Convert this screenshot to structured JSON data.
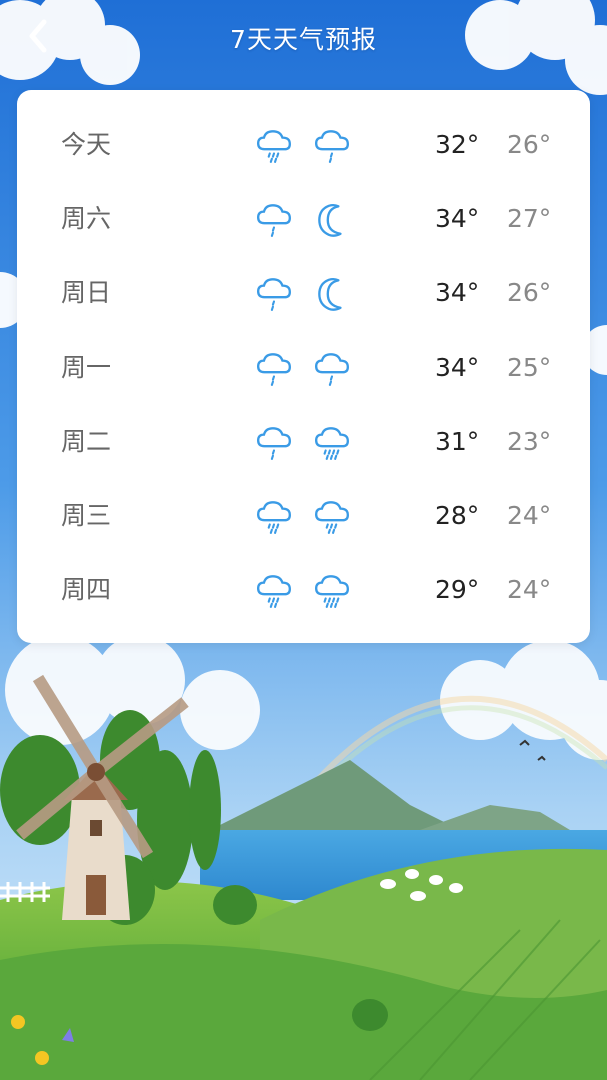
{
  "header": {
    "title": "7天天气预报",
    "back_icon": "chevron-left-icon"
  },
  "colors": {
    "sky_top": "#1f6fd6",
    "sky_bottom": "#6fb3ef",
    "icon_blue": "#3a9be6",
    "card_bg": "#ffffff"
  },
  "forecast": [
    {
      "day": "今天",
      "day_icon": "rain-cloud-icon",
      "night_icon": "light-rain-cloud-icon",
      "high": "32°",
      "low": "26°"
    },
    {
      "day": "周六",
      "day_icon": "light-rain-cloud-icon",
      "night_icon": "moon-icon",
      "high": "34°",
      "low": "27°"
    },
    {
      "day": "周日",
      "day_icon": "light-rain-cloud-icon",
      "night_icon": "moon-icon",
      "high": "34°",
      "low": "26°"
    },
    {
      "day": "周一",
      "day_icon": "light-rain-cloud-icon",
      "night_icon": "light-rain-cloud-icon",
      "high": "34°",
      "low": "25°"
    },
    {
      "day": "周二",
      "day_icon": "light-rain-cloud-icon",
      "night_icon": "heavy-rain-cloud-icon",
      "high": "31°",
      "low": "23°"
    },
    {
      "day": "周三",
      "day_icon": "rain-cloud-icon",
      "night_icon": "rain-cloud-icon",
      "high": "28°",
      "low": "24°"
    },
    {
      "day": "周四",
      "day_icon": "rain-cloud-icon",
      "night_icon": "heavy-rain-cloud-icon",
      "high": "29°",
      "low": "24°"
    }
  ]
}
